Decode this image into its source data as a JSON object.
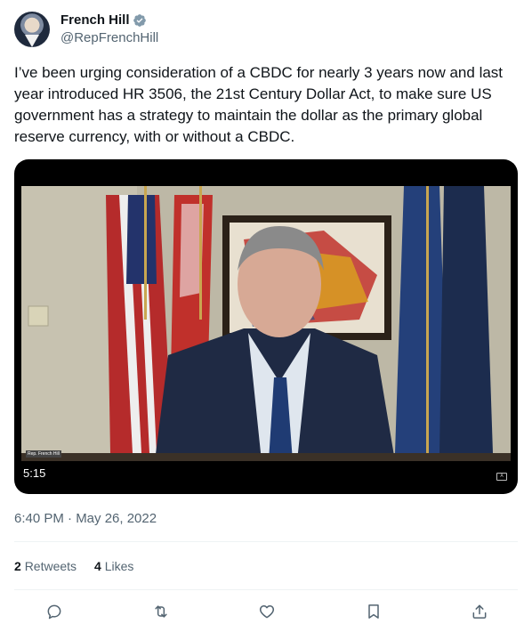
{
  "author": {
    "name": "French Hill",
    "handle": "@RepFrenchHill",
    "verified": true
  },
  "tweet": {
    "text": "I’ve been urging consideration of a CBDC for nearly 3 years now and last year introduced HR 3506, the 21st Century Dollar Act, to make sure US government has a strategy to maintain the dollar as the primary global reserve currency, with or without a CBDC.",
    "timestamp": "6:40 PM · May 26, 2022"
  },
  "media": {
    "duration": "5:15",
    "nametag": "Rep. French Hill"
  },
  "stats": {
    "retweets_count": "2",
    "retweets_label": "Retweets",
    "likes_count": "4",
    "likes_label": "Likes"
  },
  "actions": [
    {
      "icon": "reply-icon"
    },
    {
      "icon": "retweet-icon"
    },
    {
      "icon": "like-icon"
    },
    {
      "icon": "bookmark-icon"
    },
    {
      "icon": "share-icon"
    }
  ],
  "colors": {
    "verified": "#829aab",
    "secondary_text": "#536471",
    "divider": "#eff3f4"
  }
}
